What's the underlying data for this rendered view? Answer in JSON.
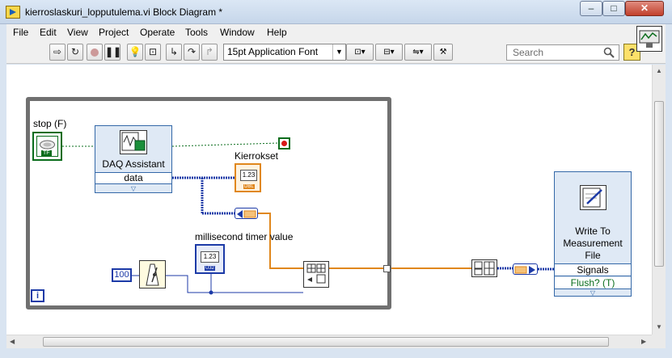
{
  "window": {
    "title": "kierroslaskuri_lopputulema.vi Block Diagram *",
    "minimize": "–",
    "maximize": "□",
    "close": "✕"
  },
  "menu": [
    "File",
    "Edit",
    "View",
    "Project",
    "Operate",
    "Tools",
    "Window",
    "Help"
  ],
  "toolbar": {
    "font_select": "15pt Application Font",
    "search_placeholder": "Search",
    "help": "?"
  },
  "diagram": {
    "stop_label": "stop (F)",
    "stop_tf": "TF",
    "daq_title": "DAQ Assistant",
    "daq_output": "data",
    "kierrokset_label": "Kierrokset",
    "kierrokset_value": "1.23",
    "kierrokset_type": "DBL",
    "timer_label": "millisecond timer value",
    "timer_value": "1.23",
    "timer_type": "U32",
    "wait_constant": "100",
    "loop_iteration": "i",
    "write_title": "Write To Measurement File",
    "write_input_signals": "Signals",
    "write_input_flush": "Flush? (T)",
    "colors": {
      "dynamic_wire": "#1c3aa7",
      "double_wire": "#e0871d",
      "boolean_wire": "#0a6d1c",
      "stop_indicator": "#d81818"
    }
  }
}
